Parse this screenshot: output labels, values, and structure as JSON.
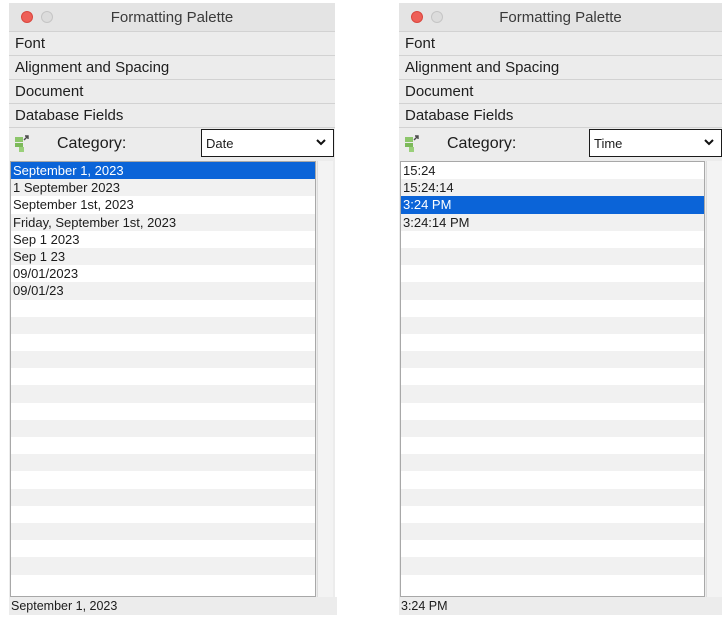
{
  "palettes": [
    {
      "title": "Formatting Palette",
      "sections": [
        "Font",
        "Alignment and Spacing",
        "Document",
        "Database Fields"
      ],
      "category_label": "Category:",
      "category_value": "Date",
      "items": [
        "September 1, 2023",
        "1 September 2023",
        "September 1st, 2023",
        "Friday, September 1st, 2023",
        "Sep 1 2023",
        "Sep 1 23",
        "09/01/2023",
        "09/01/23"
      ],
      "selected_index": 0,
      "status": "September 1, 2023"
    },
    {
      "title": "Formatting Palette",
      "sections": [
        "Font",
        "Alignment and Spacing",
        "Document",
        "Database Fields"
      ],
      "category_label": "Category:",
      "category_value": "Time",
      "items": [
        "15:24",
        "15:24:14",
        "3:24 PM",
        "3:24:14 PM"
      ],
      "selected_index": 2,
      "status": "3:24 PM"
    }
  ],
  "colors": {
    "selection": "#0b64d8",
    "close_button": "#ee5f57"
  },
  "icons": {
    "close": "close-icon",
    "minimize": "minimize-icon",
    "insert_field": "insert-field-icon",
    "dropdown": "chevron-down-icon"
  }
}
